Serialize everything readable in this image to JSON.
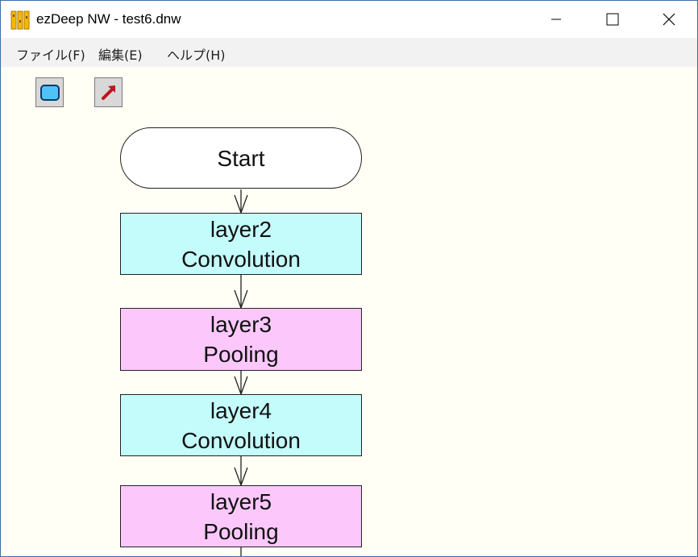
{
  "window": {
    "title": "ezDeep NW - test6.dnw",
    "controls": {
      "minimize": "minimize-icon",
      "maximize": "maximize-icon",
      "close": "close-icon"
    }
  },
  "menu": [
    {
      "label": "ファイル(F)"
    },
    {
      "label": "編集(E)"
    },
    {
      "label": "ヘルプ(H)"
    }
  ],
  "toolbar": {
    "tools": [
      {
        "name": "rectangle-tool-icon"
      },
      {
        "name": "arrow-tool-icon"
      }
    ]
  },
  "flowchart": {
    "start": {
      "label": "Start"
    },
    "layers": [
      {
        "name": "layer2",
        "type": "Convolution"
      },
      {
        "name": "layer3",
        "type": "Pooling"
      },
      {
        "name": "layer4",
        "type": "Convolution"
      },
      {
        "name": "layer5",
        "type": "Pooling"
      }
    ]
  },
  "colors": {
    "convolution": "#c4fcfc",
    "pooling": "#fcc8fc",
    "canvas": "#fffff5",
    "menubar": "#f2f2f2"
  }
}
